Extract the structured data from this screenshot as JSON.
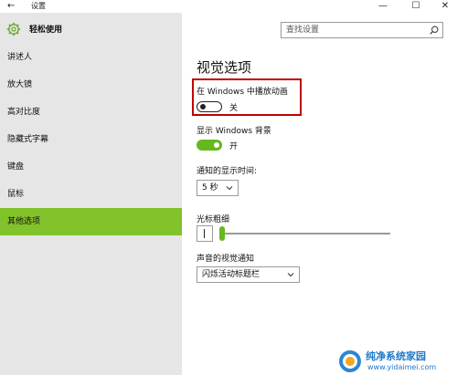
{
  "window": {
    "back_glyph": "←",
    "title": "设置",
    "minimize_glyph": "—",
    "maximize_glyph": "☐",
    "close_glyph": "✕"
  },
  "sidebar": {
    "title": "轻松使用",
    "icon": "gear-icon",
    "items": [
      {
        "label": "讲述人"
      },
      {
        "label": "放大镜"
      },
      {
        "label": "高对比度"
      },
      {
        "label": "隐藏式字幕"
      },
      {
        "label": "键盘"
      },
      {
        "label": "鼠标"
      },
      {
        "label": "其他选项",
        "active": true
      }
    ],
    "active_color": "#82c22a"
  },
  "search": {
    "placeholder": "查找设置",
    "icon": "search-icon"
  },
  "main": {
    "title": "视觉选项",
    "animations": {
      "label": "在 Windows 中播放动画",
      "state": "关",
      "on": false
    },
    "background": {
      "label": "显示 Windows 背景",
      "state": "开",
      "on": true
    },
    "notification_time": {
      "label": "通知的显示时间:",
      "value": "5 秒"
    },
    "cursor_thickness": {
      "label": "光标粗细",
      "value": 1
    },
    "visual_notification": {
      "label": "声音的视觉通知",
      "value": "闪烁活动标题栏"
    }
  },
  "colors": {
    "toggle_on": "#66b81f",
    "highlight_border": "#c00000"
  },
  "watermark": {
    "name": "纯净系统家园",
    "url": "www.yidaimei.com"
  }
}
